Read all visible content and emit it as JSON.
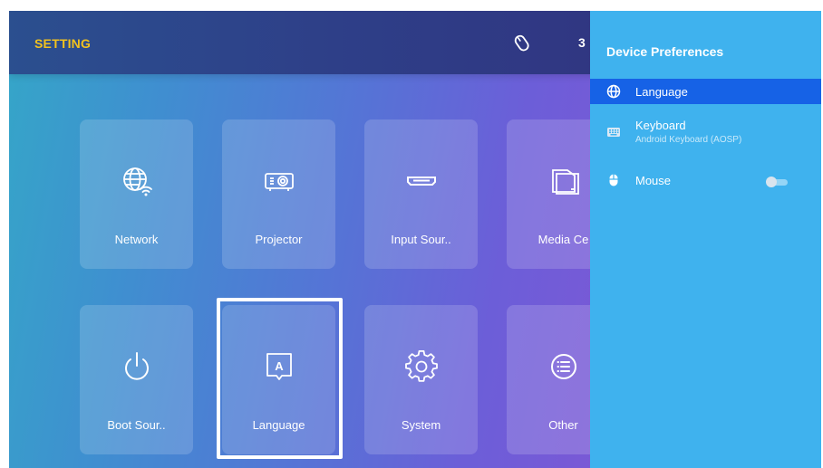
{
  "header": {
    "title": "SETTING",
    "clock_partial": "3",
    "mouse_icon": "mouse-pointer-icon"
  },
  "tiles": [
    {
      "label": "Network",
      "icon": "globe-wifi-icon"
    },
    {
      "label": "Projector",
      "icon": "projector-icon"
    },
    {
      "label": "Input Sour..",
      "icon": "hdmi-port-icon"
    },
    {
      "label": "Media Ce",
      "icon": "folder-icon"
    },
    {
      "label": "Boot Sour..",
      "icon": "power-icon"
    },
    {
      "label": "Language",
      "icon": "language-a-icon",
      "focused": true
    },
    {
      "label": "System",
      "icon": "gear-icon"
    },
    {
      "label": "Other",
      "icon": "list-circle-icon"
    }
  ],
  "panel": {
    "title": "Device Preferences",
    "items": [
      {
        "label": "Language",
        "icon": "globe-icon",
        "selected": true
      },
      {
        "label": "Keyboard",
        "sublabel": "Android Keyboard (AOSP)",
        "icon": "keyboard-icon"
      },
      {
        "label": "Mouse",
        "icon": "mouse-icon",
        "toggle": "off"
      }
    ]
  },
  "colors": {
    "title_yellow": "#f2c21e",
    "panel_blue": "#3fb2ee",
    "selected_blue": "#1662e6"
  }
}
